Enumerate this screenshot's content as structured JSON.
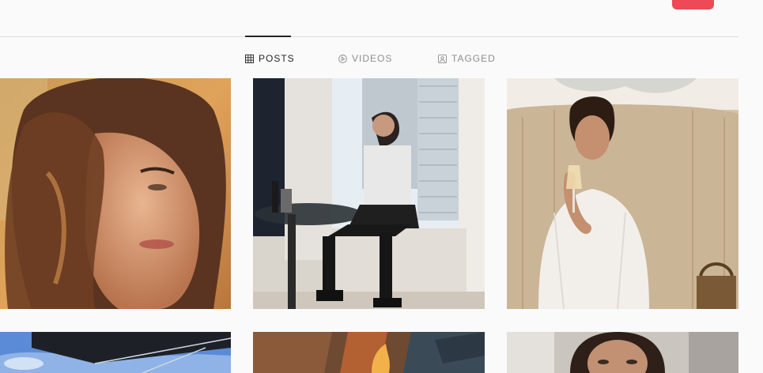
{
  "tabs": [
    {
      "label": "POSTS",
      "icon": "grid-icon",
      "active": true
    },
    {
      "label": "VIDEOS",
      "icon": "play-icon",
      "active": false
    },
    {
      "label": "TAGGED",
      "icon": "tag-icon",
      "active": false
    }
  ],
  "colors": {
    "accent": "#ed4956",
    "active_text": "#262626",
    "inactive_text": "#8e8e8e",
    "divider": "#dbdbdb",
    "background": "#fafafa"
  }
}
